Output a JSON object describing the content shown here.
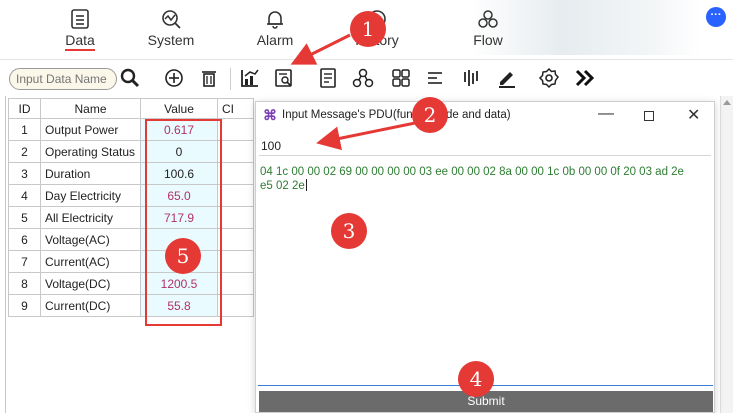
{
  "tabs": [
    {
      "label": "Data",
      "active": true
    },
    {
      "label": "System",
      "active": false
    },
    {
      "label": "Alarm",
      "active": false
    },
    {
      "label": "History",
      "active": false
    },
    {
      "label": "Flow",
      "active": false
    }
  ],
  "search": {
    "placeholder": "Input Data Name"
  },
  "table": {
    "headers": {
      "id": "ID",
      "name": "Name",
      "value": "Value",
      "extra": "CI"
    },
    "rows": [
      {
        "id": "1",
        "name": "Output Power",
        "value": "0.617"
      },
      {
        "id": "2",
        "name": "Operating Status",
        "value": "0"
      },
      {
        "id": "3",
        "name": "Duration",
        "value": "100.6"
      },
      {
        "id": "4",
        "name": "Day Electricity",
        "value": "65.0"
      },
      {
        "id": "5",
        "name": "All Electricity",
        "value": "717.9"
      },
      {
        "id": "6",
        "name": "Voltage(AC)",
        "value": ""
      },
      {
        "id": "7",
        "name": "Current(AC)",
        "value": ""
      },
      {
        "id": "8",
        "name": "Voltage(DC)",
        "value": "1200.5"
      },
      {
        "id": "9",
        "name": "Current(DC)",
        "value": "55.8"
      }
    ]
  },
  "dialog": {
    "title": "Input Message's PDU(func",
    "title_tail": "de and data)",
    "address_value": "100",
    "pdu_line1": "04 1c 00 00 02 69 00 00 00 00 03 ee 00 00 02 8a 00 00 1c 0b 00 00 0f 20 03 ad 2e",
    "pdu_line2": "e5 02 2e",
    "submit_label": "Submit"
  },
  "badges": [
    "1",
    "2",
    "3",
    "4",
    "5"
  ],
  "colors": {
    "accent": "#e53935",
    "value_text": "#b0306a",
    "value_bg": "#e9fbff",
    "submit_bg": "#6b6b6b",
    "notify": "#2962ff"
  }
}
